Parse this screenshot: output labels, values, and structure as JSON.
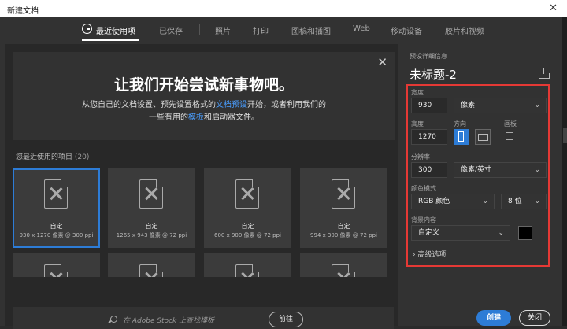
{
  "window": {
    "title": "新建文档",
    "close_glyph": "✕"
  },
  "tabs": [
    {
      "label": "最近使用项"
    },
    {
      "label": "已保存"
    },
    {
      "label": "照片"
    },
    {
      "label": "打印"
    },
    {
      "label": "图稿和插图"
    },
    {
      "label": "Web"
    },
    {
      "label": "移动设备"
    },
    {
      "label": "胶片和视频"
    }
  ],
  "hero": {
    "title": "让我们开始尝试新事物吧。",
    "text_before": "从您自己的文档设置、预先设置格式的",
    "link1": "文档预设",
    "text_mid": "开始，或者利用我们的",
    "text_line2_before": "一些有用的",
    "link2": "模板",
    "text_after": "和启动器文件。",
    "close_glyph": "✕"
  },
  "recent": {
    "title": "您最近使用的项目",
    "count": "(20)"
  },
  "cards": [
    {
      "name": "自定",
      "size": "930 x 1270 像素 @ 300 ppi"
    },
    {
      "name": "自定",
      "size": "1265 x 943 像素 @ 72 ppi"
    },
    {
      "name": "自定",
      "size": "600 x 900 像素 @ 72 ppi"
    },
    {
      "name": "自定",
      "size": "994 x 300 像素 @ 72 ppi"
    }
  ],
  "search": {
    "placeholder": "在 Adobe Stock 上查找模板",
    "go_label": "前往"
  },
  "details": {
    "section_label": "预设详细信息",
    "doc_title": "未标题-2",
    "width_label": "宽度",
    "width_value": "930",
    "width_unit": "像素",
    "height_label": "高度",
    "height_value": "1270",
    "orientation_label": "方向",
    "artboard_label": "画板",
    "resolution_label": "分辨率",
    "resolution_value": "300",
    "resolution_unit": "像素/英寸",
    "color_mode_label": "颜色模式",
    "color_mode": "RGB 颜色",
    "bit_depth": "8 位",
    "background_label": "背景内容",
    "background_value": "自定义",
    "background_color": "#000000",
    "advanced_label": "高级选项"
  },
  "buttons": {
    "create": "创建",
    "close": "关闭"
  },
  "colors": {
    "accent": "#2d7cd6",
    "highlight_box": "#e53935"
  }
}
